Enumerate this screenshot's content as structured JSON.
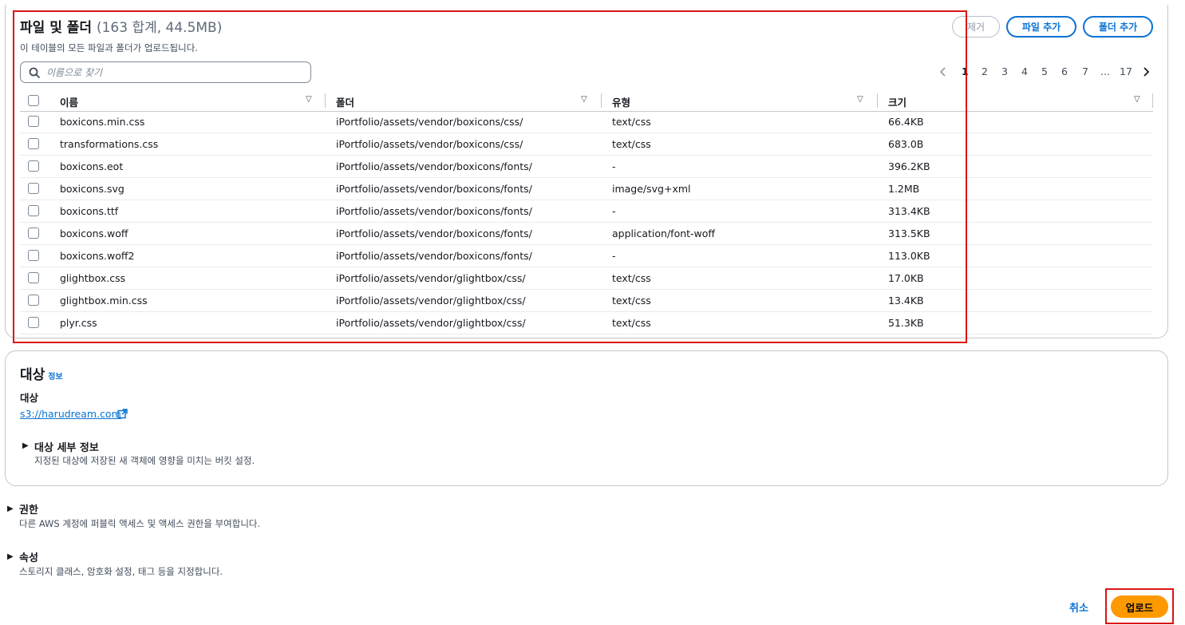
{
  "files_panel": {
    "title": "파일 및 폴더",
    "count": "(163 합계, 44.5MB)",
    "description": "이 테이블의 모든 파일과 폴더가 업로드됩니다.",
    "remove_label": "제거",
    "add_files_label": "파일 추가",
    "add_folder_label": "폴더 추가",
    "search_placeholder": "이름으로 찾기",
    "search_icon": "search-icon",
    "pagination": {
      "prev_icon": "chevron-left-icon",
      "next_icon": "chevron-right-icon",
      "pages": [
        "1",
        "2",
        "3",
        "4",
        "5",
        "6",
        "7",
        "...",
        "17"
      ],
      "current": "1"
    },
    "columns": [
      "이름",
      "폴더",
      "유형",
      "크기"
    ],
    "rows": [
      {
        "name": "boxicons.min.css",
        "folder": "iPortfolio/assets/vendor/boxicons/css/",
        "type": "text/css",
        "size": "66.4KB"
      },
      {
        "name": "transformations.css",
        "folder": "iPortfolio/assets/vendor/boxicons/css/",
        "type": "text/css",
        "size": "683.0B"
      },
      {
        "name": "boxicons.eot",
        "folder": "iPortfolio/assets/vendor/boxicons/fonts/",
        "type": "-",
        "size": "396.2KB"
      },
      {
        "name": "boxicons.svg",
        "folder": "iPortfolio/assets/vendor/boxicons/fonts/",
        "type": "image/svg+xml",
        "size": "1.2MB"
      },
      {
        "name": "boxicons.ttf",
        "folder": "iPortfolio/assets/vendor/boxicons/fonts/",
        "type": "-",
        "size": "313.4KB"
      },
      {
        "name": "boxicons.woff",
        "folder": "iPortfolio/assets/vendor/boxicons/fonts/",
        "type": "application/font-woff",
        "size": "313.5KB"
      },
      {
        "name": "boxicons.woff2",
        "folder": "iPortfolio/assets/vendor/boxicons/fonts/",
        "type": "-",
        "size": "113.0KB"
      },
      {
        "name": "glightbox.css",
        "folder": "iPortfolio/assets/vendor/glightbox/css/",
        "type": "text/css",
        "size": "17.0KB"
      },
      {
        "name": "glightbox.min.css",
        "folder": "iPortfolio/assets/vendor/glightbox/css/",
        "type": "text/css",
        "size": "13.4KB"
      },
      {
        "name": "plyr.css",
        "folder": "iPortfolio/assets/vendor/glightbox/css/",
        "type": "text/css",
        "size": "51.3KB"
      }
    ]
  },
  "destination": {
    "title": "대상",
    "info_label": "정보",
    "field_label": "대상",
    "bucket_link": "s3://harudream.com",
    "external_icon": "external-link-icon",
    "details_title": "대상 세부 정보",
    "details_desc": "지정된 대상에 저장된 새 객체에 영향을 미치는 버킷 설정."
  },
  "permissions": {
    "title": "권한",
    "desc": "다른 AWS 계정에 퍼블릭 액세스 및 액세스 권한을 부여합니다."
  },
  "properties": {
    "title": "속성",
    "desc": "스토리지 클래스, 암호화 설정, 태그 등을 지정합니다."
  },
  "footer": {
    "cancel_label": "취소",
    "upload_label": "업로드"
  },
  "colors": {
    "accent": "#0972d3",
    "primary_button": "#ff9900",
    "highlight_box": "#d91515"
  }
}
